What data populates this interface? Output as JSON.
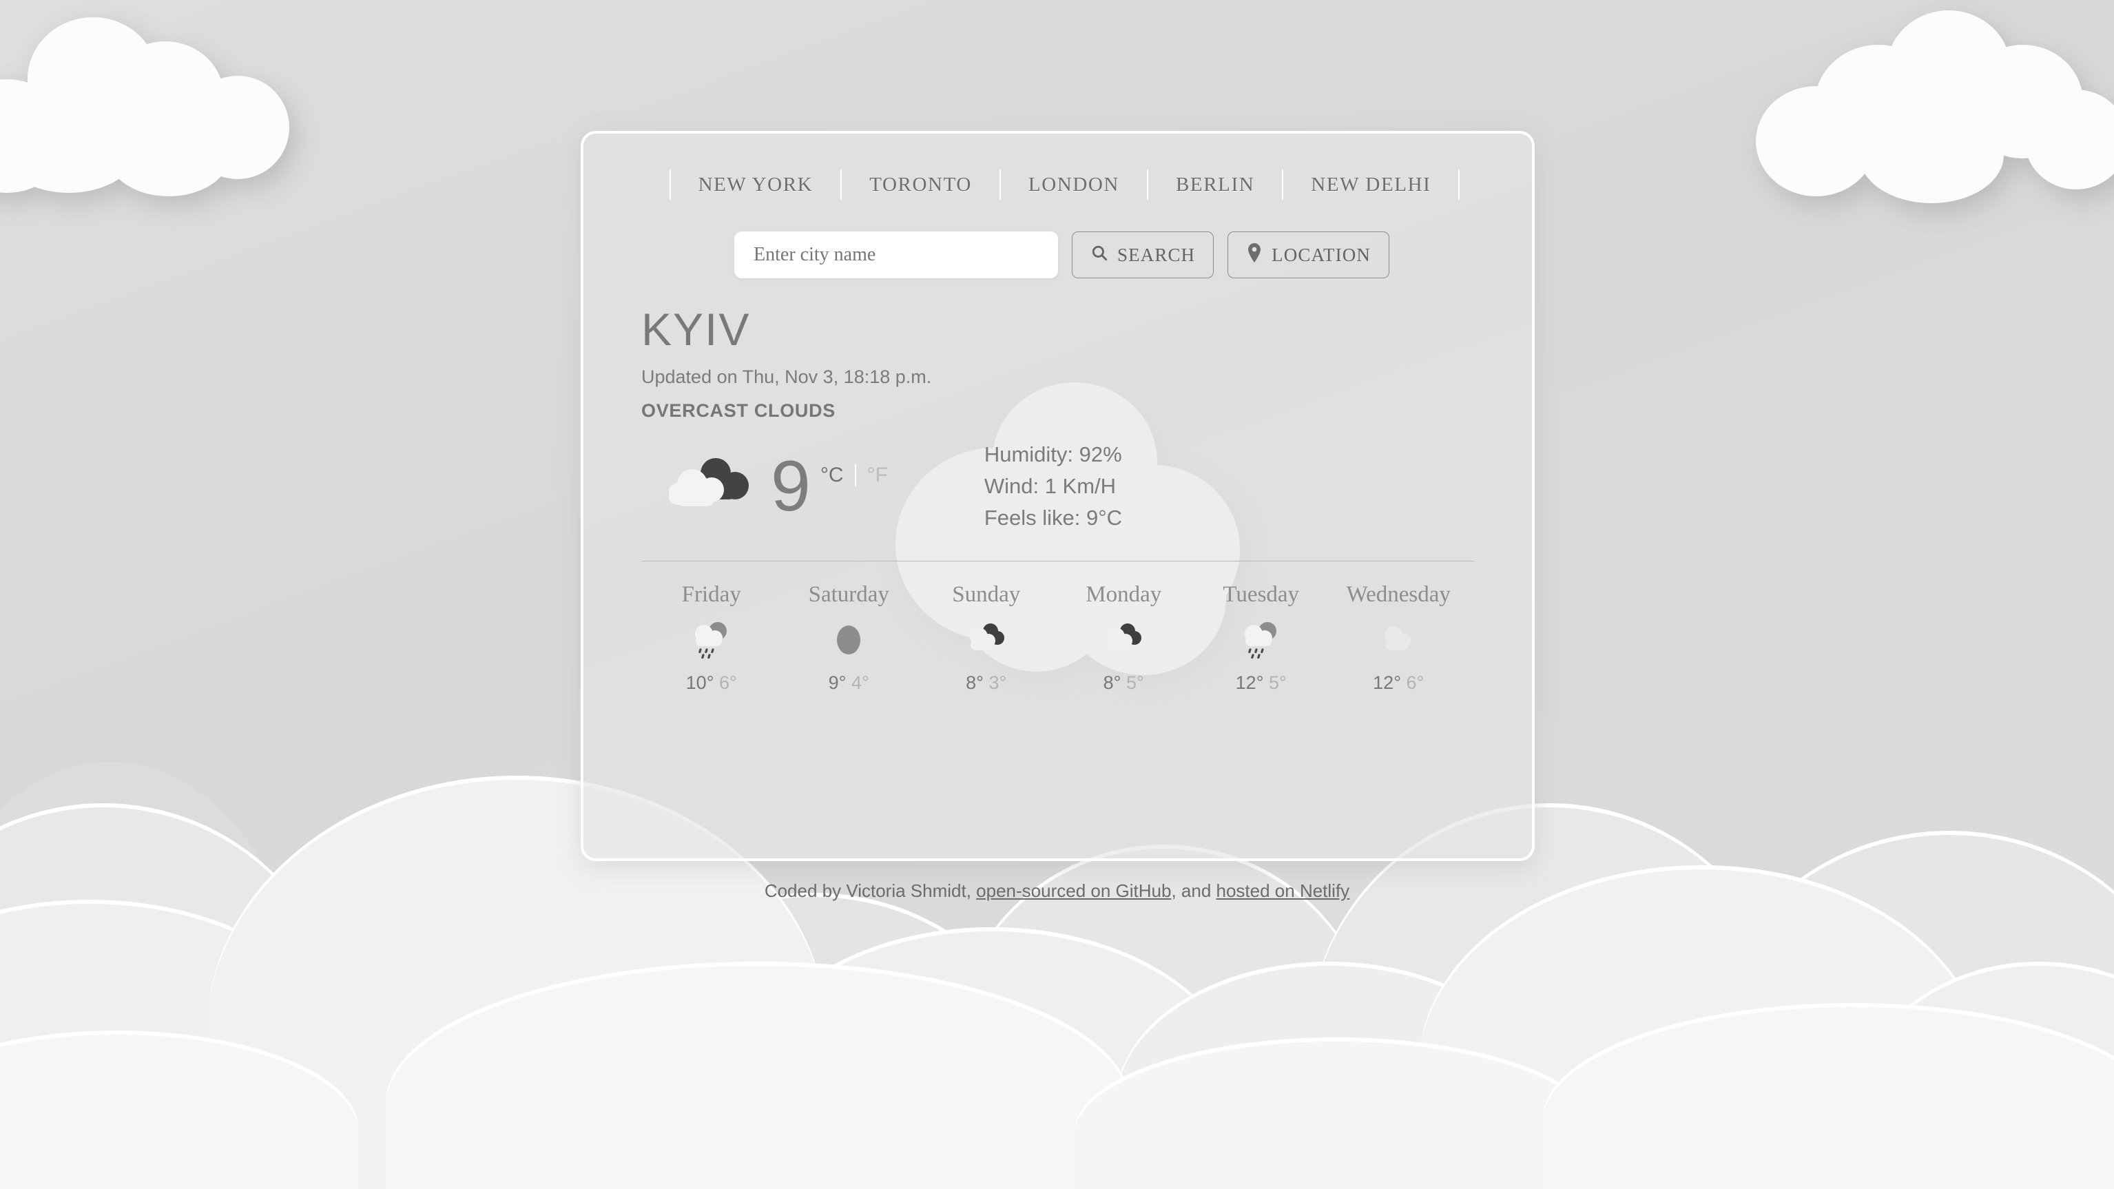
{
  "nav": {
    "cities": [
      "NEW YORK",
      "TORONTO",
      "LONDON",
      "BERLIN",
      "NEW DELHI"
    ]
  },
  "search": {
    "placeholder": "Enter city name",
    "value": "",
    "search_label": "SEARCH",
    "search_icon": "search-icon",
    "location_label": "LOCATION",
    "location_icon": "map-pin-icon"
  },
  "current": {
    "city": "KYIV",
    "updated": "Updated on Thu, Nov 3, 18:18 p.m.",
    "description": "OVERCAST CLOUDS",
    "icon": "overcast-clouds-icon",
    "temperature": "9",
    "unit_celsius": "°C",
    "unit_fahrenheit": "°F",
    "active_unit": "celsius",
    "humidity": "Humidity: 92%",
    "wind": "Wind: 1 Km/H",
    "feels_like": "Feels like: 9°C"
  },
  "forecast": [
    {
      "day": "Friday",
      "icon": "rain-sun-icon",
      "max": "10°",
      "min": "6°"
    },
    {
      "day": "Saturday",
      "icon": "clear-sun-icon",
      "max": "9°",
      "min": "4°"
    },
    {
      "day": "Sunday",
      "icon": "overcast-clouds-icon",
      "max": "8°",
      "min": "3°"
    },
    {
      "day": "Monday",
      "icon": "overcast-clouds-icon",
      "max": "8°",
      "min": "5°"
    },
    {
      "day": "Tuesday",
      "icon": "rain-sun-icon",
      "max": "12°",
      "min": "5°"
    },
    {
      "day": "Wednesday",
      "icon": "few-clouds-icon",
      "max": "12°",
      "min": "6°"
    }
  ],
  "footer": {
    "prefix": "Coded by Victoria Shmidt, ",
    "link_github": "open-sourced on GitHub",
    "middle": ", and ",
    "link_netlify": "hosted on Netlify"
  },
  "colors": {
    "sky": "#dcdcdc",
    "cloud": "#fcfcfc",
    "card_border": "#ffffff",
    "text_primary": "#7b7b7b",
    "text_muted": "#b3b3b3",
    "icon_dark": "#434343"
  }
}
